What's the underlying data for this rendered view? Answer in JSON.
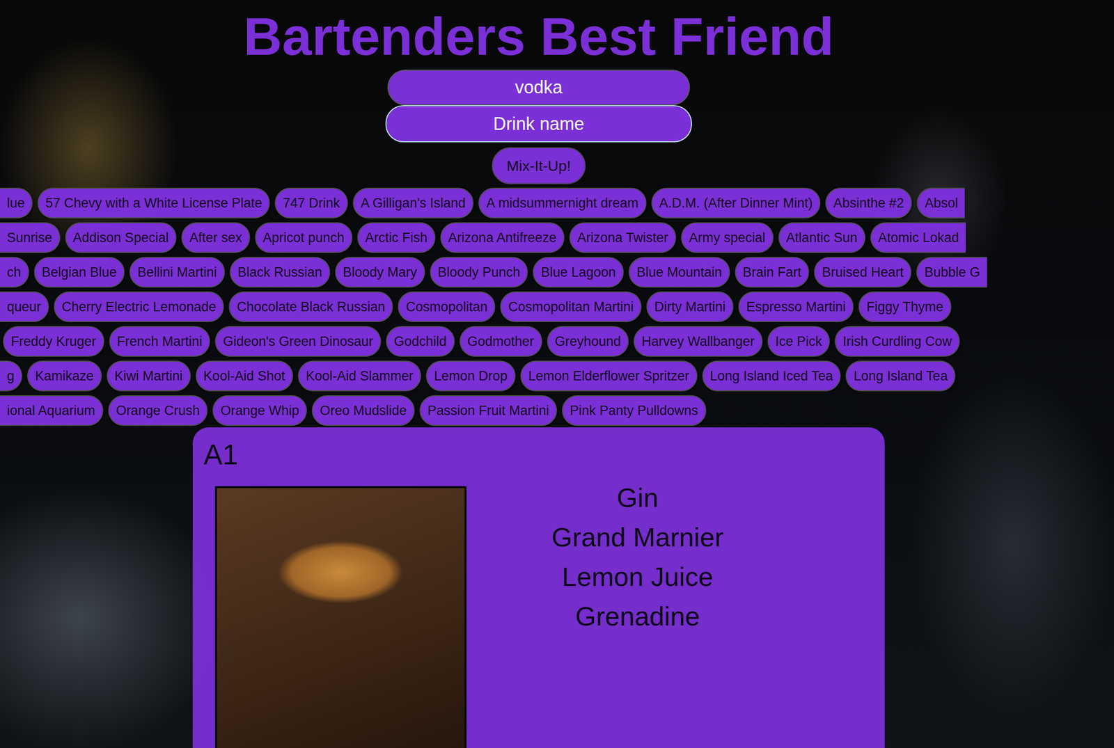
{
  "app": {
    "title": "Bartenders Best Friend"
  },
  "search": {
    "fields": [
      {
        "value": "vodka",
        "focused": false
      },
      {
        "placeholder": "Drink name",
        "focused": true
      }
    ],
    "button": "Mix-It-Up!"
  },
  "drink_rows": [
    {
      "clipped_left": true,
      "clipped_right": true,
      "drinks": [
        "lue",
        "57 Chevy with a White License Plate",
        "747 Drink",
        "A Gilligan's Island",
        "A midsummernight dream",
        "A.D.M. (After Dinner Mint)",
        "Absinthe #2",
        "Absol"
      ]
    },
    {
      "clipped_left": true,
      "clipped_right": true,
      "drinks": [
        "Sunrise",
        "Addison Special",
        "After sex",
        "Apricot punch",
        "Arctic Fish",
        "Arizona Antifreeze",
        "Arizona Twister",
        "Army special",
        "Atlantic Sun",
        "Atomic Lokad"
      ]
    },
    {
      "clipped_left": true,
      "clipped_right": true,
      "drinks": [
        "ch",
        "Belgian Blue",
        "Bellini Martini",
        "Black Russian",
        "Bloody Mary",
        "Bloody Punch",
        "Blue Lagoon",
        "Blue Mountain",
        "Brain Fart",
        "Bruised Heart",
        "Bubble G"
      ]
    },
    {
      "clipped_left": true,
      "clipped_right": false,
      "drinks": [
        "queur",
        "Cherry Electric Lemonade",
        "Chocolate Black Russian",
        "Cosmopolitan",
        "Cosmopolitan Martini",
        "Dirty Martini",
        "Espresso Martini",
        "Figgy Thyme"
      ]
    },
    {
      "clipped_left": false,
      "clipped_right": false,
      "drinks": [
        "Freddy Kruger",
        "French Martini",
        "Gideon's Green Dinosaur",
        "Godchild",
        "Godmother",
        "Greyhound",
        "Harvey Wallbanger",
        "Ice Pick",
        "Irish Curdling Cow"
      ]
    },
    {
      "clipped_left": true,
      "clipped_right": false,
      "drinks": [
        "g",
        "Kamikaze",
        "Kiwi Martini",
        "Kool-Aid Shot",
        "Kool-Aid Slammer",
        "Lemon Drop",
        "Lemon Elderflower Spritzer",
        "Long Island Iced Tea",
        "Long Island Tea"
      ]
    },
    {
      "clipped_left": true,
      "clipped_right": false,
      "drinks": [
        "ional Aquarium",
        "Orange Crush",
        "Orange Whip",
        "Oreo Mudslide",
        "Passion Fruit Martini",
        "Pink Panty Pulldowns"
      ]
    }
  ],
  "selected_drink": {
    "name": "A1",
    "ingredients": [
      "Gin",
      "Grand Marnier",
      "Lemon Juice",
      "Grenadine"
    ]
  }
}
